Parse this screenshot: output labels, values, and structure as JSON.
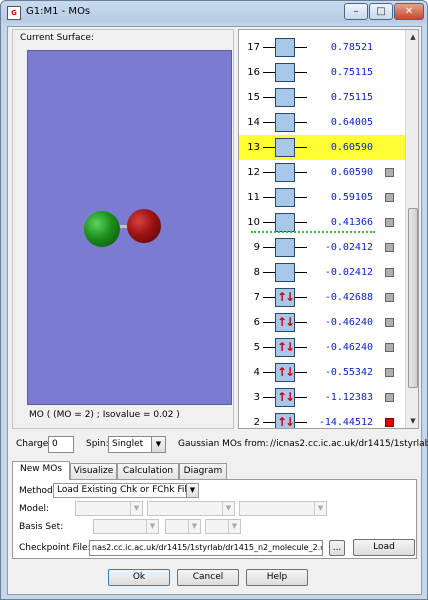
{
  "window": {
    "title": "G1:M1 - MOs",
    "icon": "gaussview-icon"
  },
  "surface": {
    "label": "Current Surface:",
    "caption": "MO ( (MO = 2) ; Isovalue = 0.02 )",
    "colors": {
      "background": "#7b7bd2",
      "positive_lobe": "#1a8f1a",
      "negative_lobe": "#9c1212"
    }
  },
  "orbitals": [
    {
      "num": "17",
      "energy": "0.78521",
      "occ": "",
      "checkbox": false
    },
    {
      "num": "16",
      "energy": "0.75115",
      "occ": "",
      "checkbox": false
    },
    {
      "num": "15",
      "energy": "0.75115",
      "occ": "",
      "checkbox": false
    },
    {
      "num": "14",
      "energy": "0.64005",
      "occ": "",
      "checkbox": false
    },
    {
      "num": "13",
      "energy": "0.60590",
      "occ": "",
      "checkbox": false,
      "selected": true
    },
    {
      "num": "12",
      "energy": "0.60590",
      "occ": "",
      "checkbox": true
    },
    {
      "num": "11",
      "energy": "0.59105",
      "occ": "",
      "checkbox": true
    },
    {
      "num": "10",
      "energy": "0.41366",
      "occ": "",
      "checkbox": true
    },
    {
      "num": "9",
      "energy": "-0.02412",
      "occ": "",
      "checkbox": true
    },
    {
      "num": "8",
      "energy": "-0.02412",
      "occ": "",
      "checkbox": true
    },
    {
      "num": "7",
      "energy": "-0.42688",
      "occ": "↑↓",
      "checkbox": true
    },
    {
      "num": "6",
      "energy": "-0.46240",
      "occ": "↑↓",
      "checkbox": true
    },
    {
      "num": "5",
      "energy": "-0.46240",
      "occ": "↑↓",
      "checkbox": true
    },
    {
      "num": "4",
      "energy": "-0.55342",
      "occ": "↑↓",
      "checkbox": true
    },
    {
      "num": "3",
      "energy": "-1.12383",
      "occ": "↑↓",
      "checkbox": true
    },
    {
      "num": "2",
      "energy": "-14.44512",
      "occ": "↑↓",
      "checkbox": true,
      "checked": true
    }
  ],
  "controls": {
    "charge_label": "Charge:",
    "charge_value": "0",
    "spin_label": "Spin:",
    "spin_value": "Singlet",
    "gaussian_label": "Gaussian MOs from:",
    "gaussian_path": "//icnas2.cc.ic.ac.uk/dr1415/1styrlab"
  },
  "tabs": [
    "New MOs",
    "Visualize",
    "Calculation",
    "Diagram"
  ],
  "new_mos": {
    "method_label": "Method:",
    "method_value": "Load Existing Chk or FChk File",
    "model_label": "Model:",
    "basis_label": "Basis Set:",
    "checkpoint_label": "Checkpoint File:",
    "checkpoint_value": "nas2.cc.ic.ac.uk/dr1415/1styrlab/dr1415_n2_molecule_2.chk",
    "browse_label": "...",
    "load_label": "Load"
  },
  "buttons": {
    "ok": "Ok",
    "cancel": "Cancel",
    "help": "Help"
  }
}
